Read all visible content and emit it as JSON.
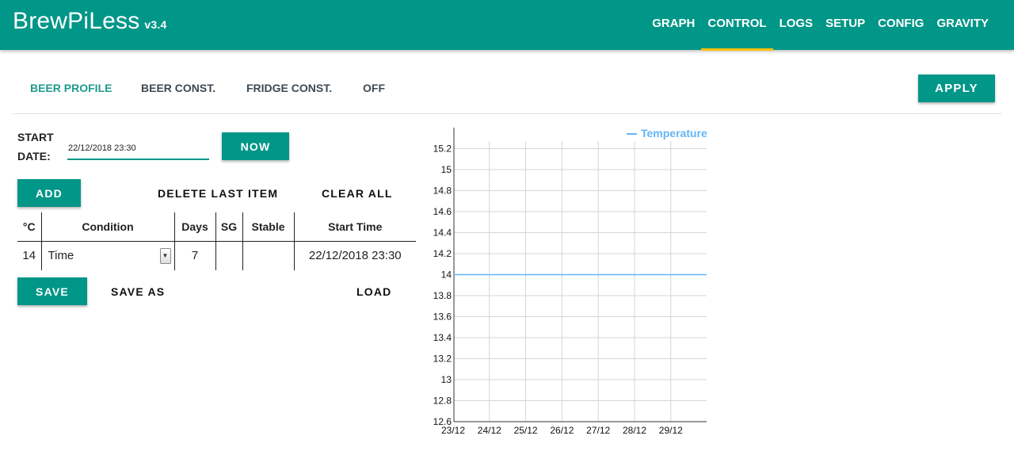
{
  "app": {
    "name": "BrewPiLess",
    "version": "v3.4"
  },
  "nav": [
    "GRAPH",
    "CONTROL",
    "LOGS",
    "SETUP",
    "CONFIG",
    "GRAVITY"
  ],
  "modes": [
    "BEER PROFILE",
    "BEER CONST.",
    "FRIDGE CONST.",
    "OFF"
  ],
  "buttons": {
    "apply": "APPLY",
    "now": "NOW",
    "add": "ADD",
    "delete_last": "DELETE LAST ITEM",
    "clear_all": "CLEAR ALL",
    "save": "SAVE",
    "save_as": "SAVE AS",
    "load": "LOAD"
  },
  "start": {
    "label_line1": "START",
    "label_line2": "DATE:",
    "value": "22/12/2018 23:30"
  },
  "table": {
    "headers": [
      "°C",
      "Condition",
      "Days",
      "SG",
      "Stable",
      "Start Time"
    ],
    "rows": [
      {
        "temp": "14",
        "condition": "Time",
        "days": "7",
        "sg": "",
        "stable": "",
        "start_time": "22/12/2018 23:30"
      }
    ]
  },
  "colors": {
    "primary": "#009688",
    "accent": "#ffc107",
    "series": "#64b5f6"
  },
  "chart_data": {
    "type": "line",
    "series": [
      {
        "name": "Temperature",
        "x": [
          "23/12",
          "24/12",
          "25/12",
          "26/12",
          "27/12",
          "28/12",
          "29/12",
          "29/12 end"
        ],
        "values": [
          14,
          14,
          14,
          14,
          14,
          14,
          14,
          14
        ]
      }
    ],
    "x_ticks": [
      "23/12",
      "24/12",
      "25/12",
      "26/12",
      "27/12",
      "28/12",
      "29/12"
    ],
    "y_ticks": [
      "15.2",
      "15",
      "14.8",
      "14.6",
      "14.4",
      "14.2",
      "14",
      "13.8",
      "13.6",
      "13.4",
      "13.2",
      "13",
      "12.8",
      "12.6"
    ],
    "ylim": [
      12.6,
      15.2
    ],
    "grid": true,
    "legend": "top-right"
  }
}
